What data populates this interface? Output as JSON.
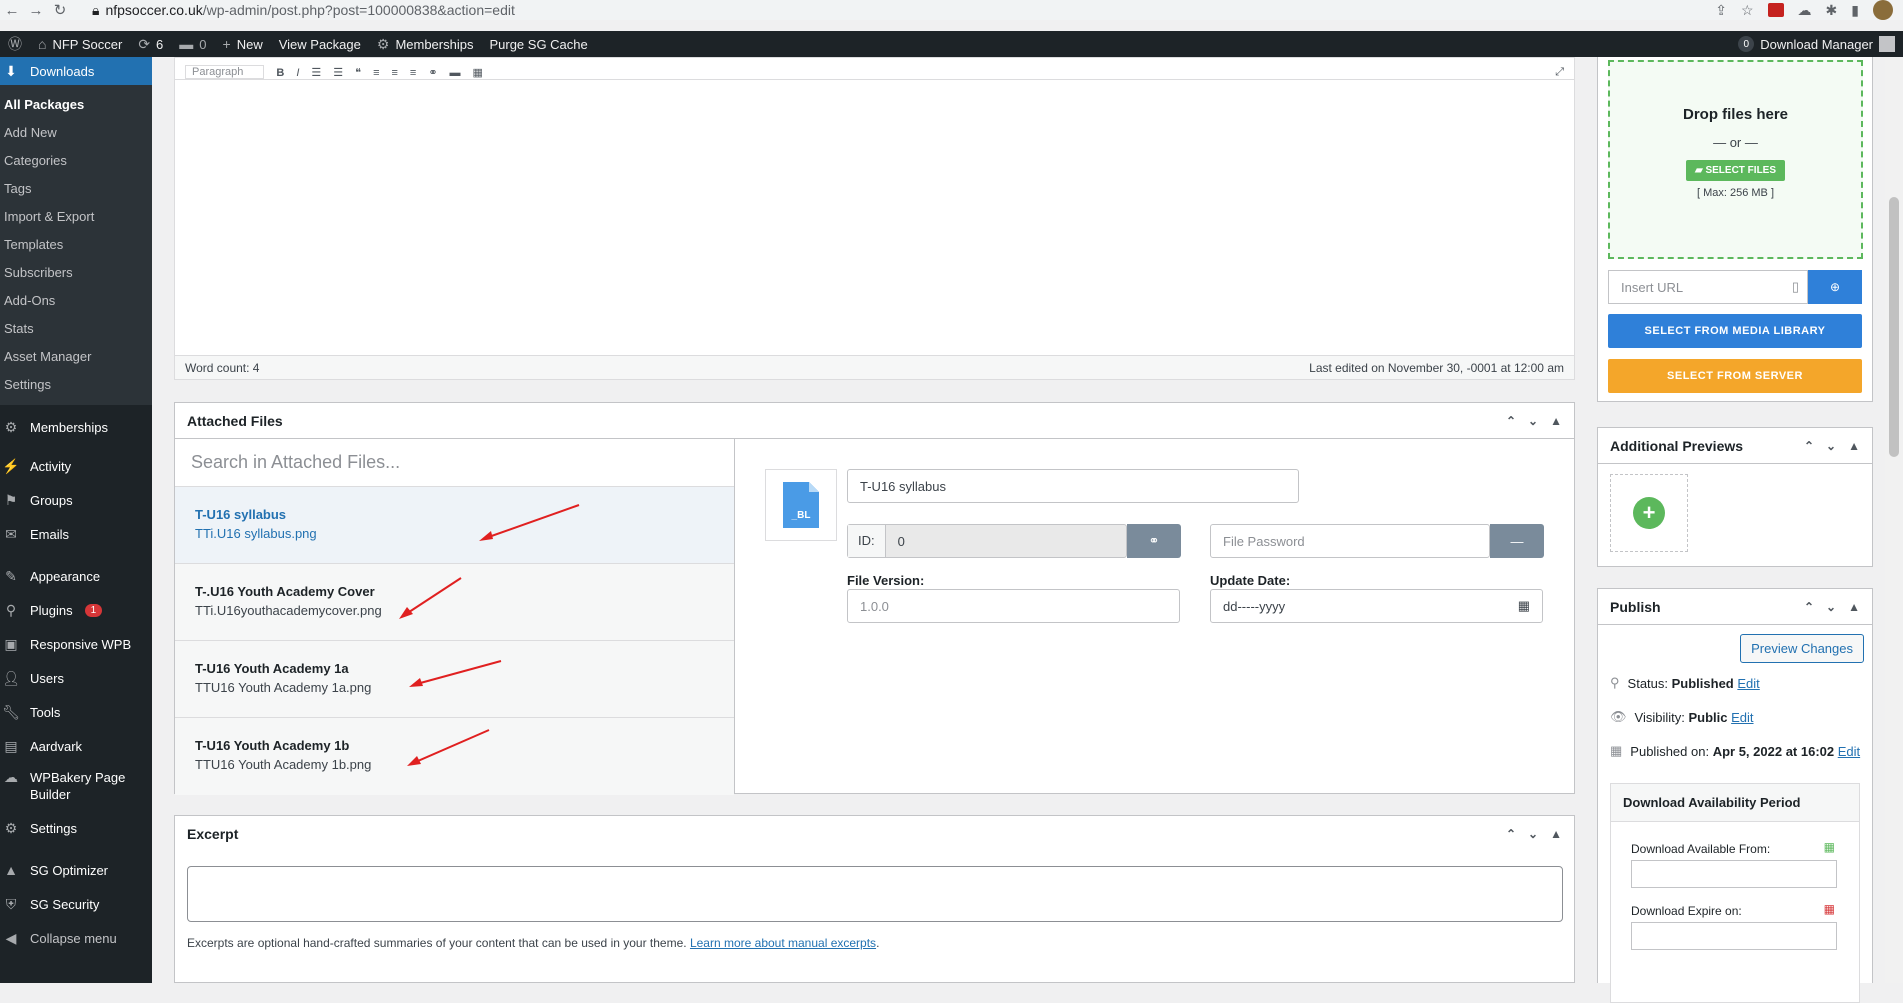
{
  "browser": {
    "url_host": "nfpsoccer.co.uk",
    "url_path": "/wp-admin/post.php?post=100000838&action=edit"
  },
  "adminbar": {
    "site_name": "NFP Soccer",
    "updates_count": "6",
    "comments_count": "0",
    "new_label": "New",
    "view_label": "View Package",
    "memberships_label": "Memberships",
    "purge_label": "Purge SG Cache",
    "right_count": "0",
    "right_label": "Download Manager"
  },
  "sidebar": {
    "downloads_label": "Downloads",
    "submenu": [
      "All Packages",
      "Add New",
      "Categories",
      "Tags",
      "Import & Export",
      "Templates",
      "Subscribers",
      "Add-Ons",
      "Stats",
      "Asset Manager",
      "Settings"
    ],
    "items": [
      {
        "label": "Memberships",
        "icon": "memberships-icon"
      },
      {
        "label": "Activity",
        "icon": "activity-icon"
      },
      {
        "label": "Groups",
        "icon": "groups-icon"
      },
      {
        "label": "Emails",
        "icon": "emails-icon"
      },
      {
        "label": "Appearance",
        "icon": "appearance-icon"
      },
      {
        "label": "Plugins",
        "icon": "plugins-icon",
        "badge": "1"
      },
      {
        "label": "Responsive WPB",
        "icon": "responsive-icon"
      },
      {
        "label": "Users",
        "icon": "users-icon"
      },
      {
        "label": "Tools",
        "icon": "tools-icon"
      },
      {
        "label": "Aardvark",
        "icon": "aardvark-icon"
      },
      {
        "label": "WPBakery Page Builder",
        "icon": "wpbakery-icon"
      },
      {
        "label": "Settings",
        "icon": "settings-icon"
      },
      {
        "label": "SG Optimizer",
        "icon": "sg-optimizer-icon"
      },
      {
        "label": "SG Security",
        "icon": "sg-security-icon"
      },
      {
        "label": "Collapse menu",
        "icon": "collapse-icon"
      }
    ]
  },
  "editor": {
    "toolbar_hint": "Paragraph",
    "word_count": "Word count: 4",
    "last_edited": "Last edited on November 30, -0001 at 12:00 am"
  },
  "attached": {
    "title": "Attached Files",
    "search_placeholder": "Search in Attached Files...",
    "files": [
      {
        "title": "T-U16 syllabus",
        "file": "TTi.U16 syllabus.png"
      },
      {
        "title": "T-.U16 Youth Academy Cover",
        "file": "TTi.U16youthacademycover.png"
      },
      {
        "title": "T-U16 Youth Academy 1a",
        "file": "TTU16 Youth Academy 1a.png"
      },
      {
        "title": "T-U16 Youth Academy 1b",
        "file": "TTU16 Youth Academy 1b.png"
      }
    ],
    "detail": {
      "thumb_label": "_BL",
      "name_value": "T-U16 syllabus",
      "id_label": "ID:",
      "id_value": "0",
      "password_placeholder": "File Password",
      "version_label": "File Version:",
      "version_placeholder": "1.0.0",
      "update_label": "Update Date:",
      "update_placeholder": "dd-----yyyy"
    }
  },
  "excerpt": {
    "title": "Excerpt",
    "help": "Excerpts are optional hand-crafted summaries of your content that can be used in your theme.",
    "help_link": "Learn more about manual excerpts",
    "help_end": "."
  },
  "upload": {
    "drop_title": "Drop files here",
    "or": "— or —",
    "select_files": "SELECT FILES",
    "max": "[ Max: 256 MB ]",
    "insert_url_placeholder": "Insert URL",
    "media_library": "SELECT FROM MEDIA LIBRARY",
    "server": "SELECT FROM SERVER"
  },
  "previews": {
    "title": "Additional Previews"
  },
  "publish": {
    "title": "Publish",
    "preview_button": "Preview Changes",
    "status_label": "Status:",
    "status_value": "Published",
    "visibility_label": "Visibility:",
    "visibility_value": "Public",
    "published_label": "Published on:",
    "published_value": "Apr 5, 2022 at 16:02",
    "edit": "Edit",
    "availability_title": "Download Availability Period",
    "available_from": "Download Available From:",
    "expire_on": "Download Expire on:"
  },
  "colors": {
    "wp_blue": "#2271b1",
    "green": "#5cb85c",
    "orange": "#f4a62a",
    "sidebar": "#1d2327",
    "arrow": "#e02020"
  }
}
